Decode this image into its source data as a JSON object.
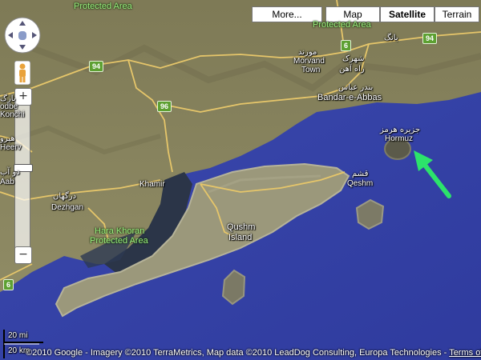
{
  "map_type_buttons": {
    "more": "More...",
    "map": "Map",
    "satellite": "Satellite",
    "terrain": "Terrain",
    "active": "Satellite"
  },
  "labels": {
    "protected_area_top": "Protected Area",
    "protected_area_right": "Protected Area",
    "morvand_fa": "مورند",
    "morvand_line1": "Morvand",
    "morvand_line2": "Town",
    "bang_fa": "بانگ",
    "shahrak_fa_line1": "شهرک",
    "shahrak_fa_line2": "راه آهن",
    "bandar_fa": "بندر عباس",
    "bandar_en": "Bandar-e-Abbas",
    "hormuz_fa": "جزیره هرمز",
    "hormuz_en": "Hormuz",
    "qeshm_fa": "قشم",
    "qeshm_en": "Qeshm",
    "khamir": "Khamir",
    "dargahan_fa": "درگهان",
    "dargahan_en": "Dezhgan",
    "hara_khoran_line1": "Hara Khoran",
    "hara_khoran_line2": "Protected Area",
    "qushm_line1": "Qushm",
    "qushm_line2": "Island",
    "left_fa_1": "بارگ",
    "left_en_1": "odbe",
    "left_en_1b": "Konchi",
    "left_fa_2": "هیرو",
    "left_en_2": "Heerv",
    "left_fa_3": "دو آب",
    "left_en_3": "Aab"
  },
  "roads": {
    "shield_94_left": "94",
    "shield_94_right": "94",
    "shield_96": "96",
    "shield_6_left": "6",
    "shield_6_right": "6"
  },
  "scale": {
    "miles": "20 mi",
    "km": "20 km"
  },
  "attribution": {
    "text": "©2010 Google - Imagery ©2010 TerraMetrics, Map data ©2010 LeadDog Consulting, Europa Technologies - ",
    "terms": "Terms of Use"
  },
  "colors": {
    "land": "#8a8561",
    "sea": "#3743a8",
    "island": "#9a987a",
    "road": "#e6c66a",
    "arrow": "#2ce36b"
  },
  "icons": {
    "pan": "pan-control-icon",
    "pegman": "street-view-pegman-icon",
    "arrow": "green-arrow-icon"
  }
}
